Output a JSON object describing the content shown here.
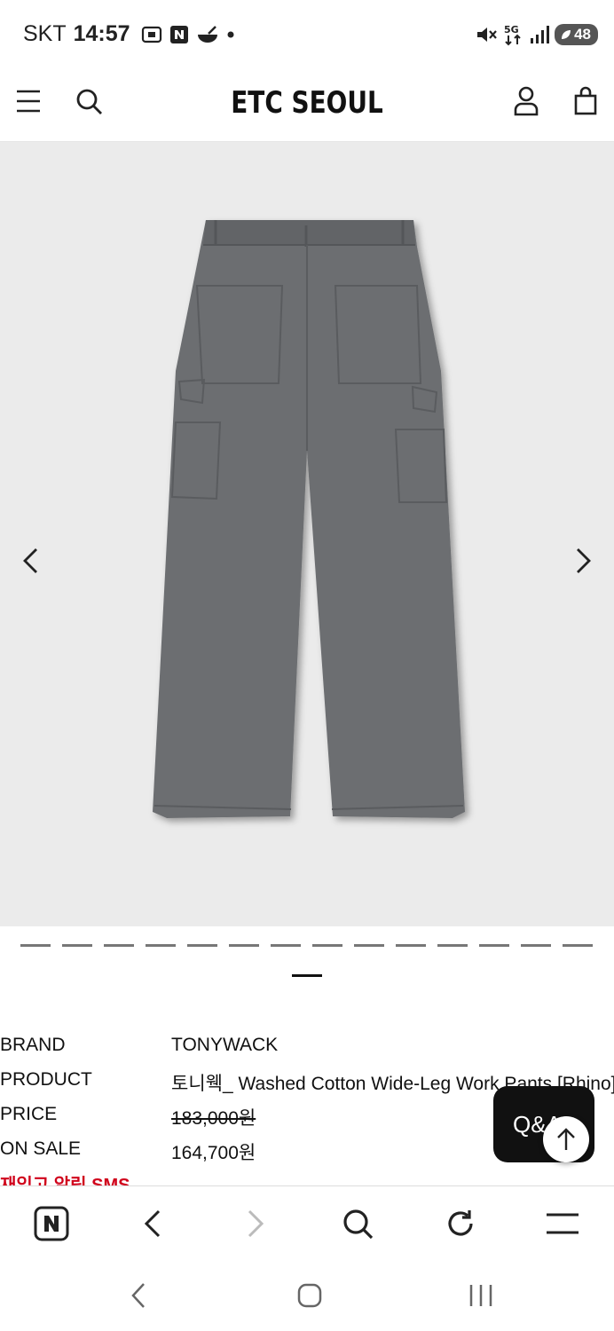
{
  "status_bar": {
    "carrier": "SKT",
    "time": "14:57",
    "battery": "48",
    "network": "5G"
  },
  "header": {
    "logo": "ETC SEOUL"
  },
  "gallery": {
    "slide_count": 14,
    "current_slide": 8,
    "product_color": "#6c6e71"
  },
  "product_info": {
    "rows": [
      {
        "key": "BRAND",
        "value": "TONYWACK"
      },
      {
        "key": "PRODUCT",
        "value": "토니웩_ Washed Cotton Wide-Leg Work Pants [Rhino]"
      },
      {
        "key": "PRICE",
        "value": "183,000원"
      },
      {
        "key": "ON SALE",
        "value": "164,700원"
      }
    ],
    "restock_alert": "재입고 알림 SMS"
  },
  "floating": {
    "qa_label": "Q&A"
  },
  "browser_toolbar": {
    "items": [
      "naver-home",
      "back",
      "forward",
      "search",
      "refresh",
      "menu"
    ]
  },
  "colors": {
    "accent_red": "#d0021b",
    "gallery_bg": "#ebebeb"
  }
}
